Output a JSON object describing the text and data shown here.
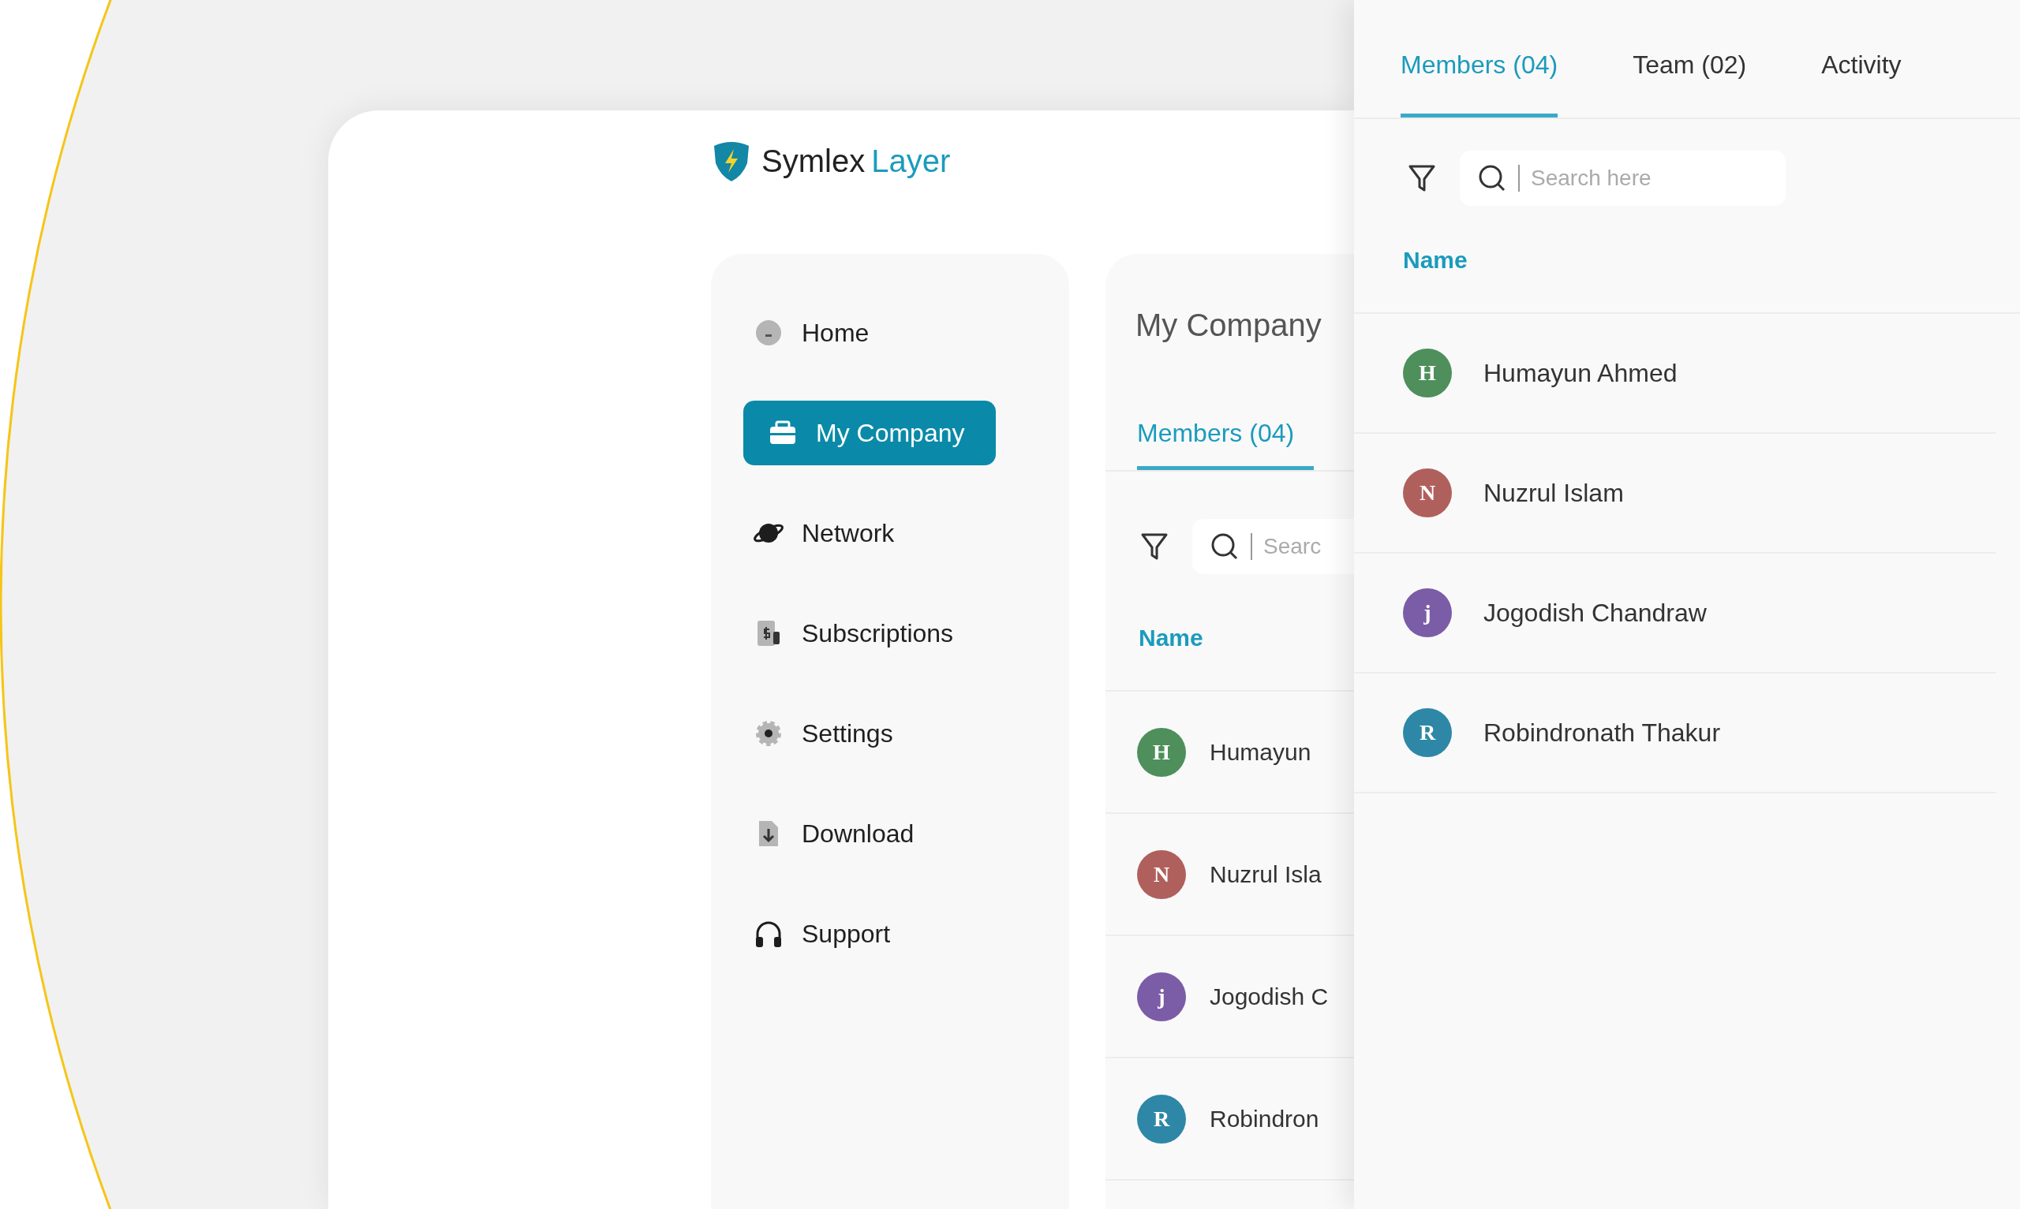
{
  "logo": {
    "text": "Symlex",
    "accent": "Layer"
  },
  "sidebar": {
    "items": [
      {
        "label": "Home",
        "kind": "home",
        "selected": false
      },
      {
        "label": "My Company",
        "kind": "briefcase",
        "selected": true
      },
      {
        "label": "Network",
        "kind": "planet",
        "selected": false
      },
      {
        "label": "Subscriptions",
        "kind": "invoice",
        "selected": false
      },
      {
        "label": "Settings",
        "kind": "gear",
        "selected": false
      },
      {
        "label": "Download",
        "kind": "download",
        "selected": false
      },
      {
        "label": "Support",
        "kind": "headphones",
        "selected": false
      }
    ]
  },
  "company_panel": {
    "title": "My Company",
    "tabs": [
      {
        "label": "Members (04)",
        "selected": true
      }
    ],
    "search": {
      "placeholder": "Searc"
    },
    "column_header": "Name",
    "members": [
      {
        "initial": "H",
        "name": "Humayun",
        "color": "#4e8f5c"
      },
      {
        "initial": "N",
        "name": "Nuzrul Isla",
        "color": "#b0605c"
      },
      {
        "initial": "j",
        "name": "Jogodish C",
        "color": "#7b5ca6"
      },
      {
        "initial": "R",
        "name": "Robindron",
        "color": "#2e87a6"
      }
    ]
  },
  "members_panel": {
    "tabs": [
      {
        "label": "Members (04)",
        "selected": true
      },
      {
        "label": "Team (02)",
        "selected": false
      },
      {
        "label": "Activity",
        "selected": false
      }
    ],
    "search": {
      "placeholder": "Search here"
    },
    "column_header": "Name",
    "members": [
      {
        "initial": "H",
        "name": "Humayun Ahmed",
        "color": "#4e8f5c"
      },
      {
        "initial": "N",
        "name": "Nuzrul Islam",
        "color": "#b0605c"
      },
      {
        "initial": "j",
        "name": "Jogodish Chandraw",
        "color": "#7b5ca6"
      },
      {
        "initial": "R",
        "name": "Robindronath Thakur",
        "color": "#2e87a6"
      }
    ]
  }
}
